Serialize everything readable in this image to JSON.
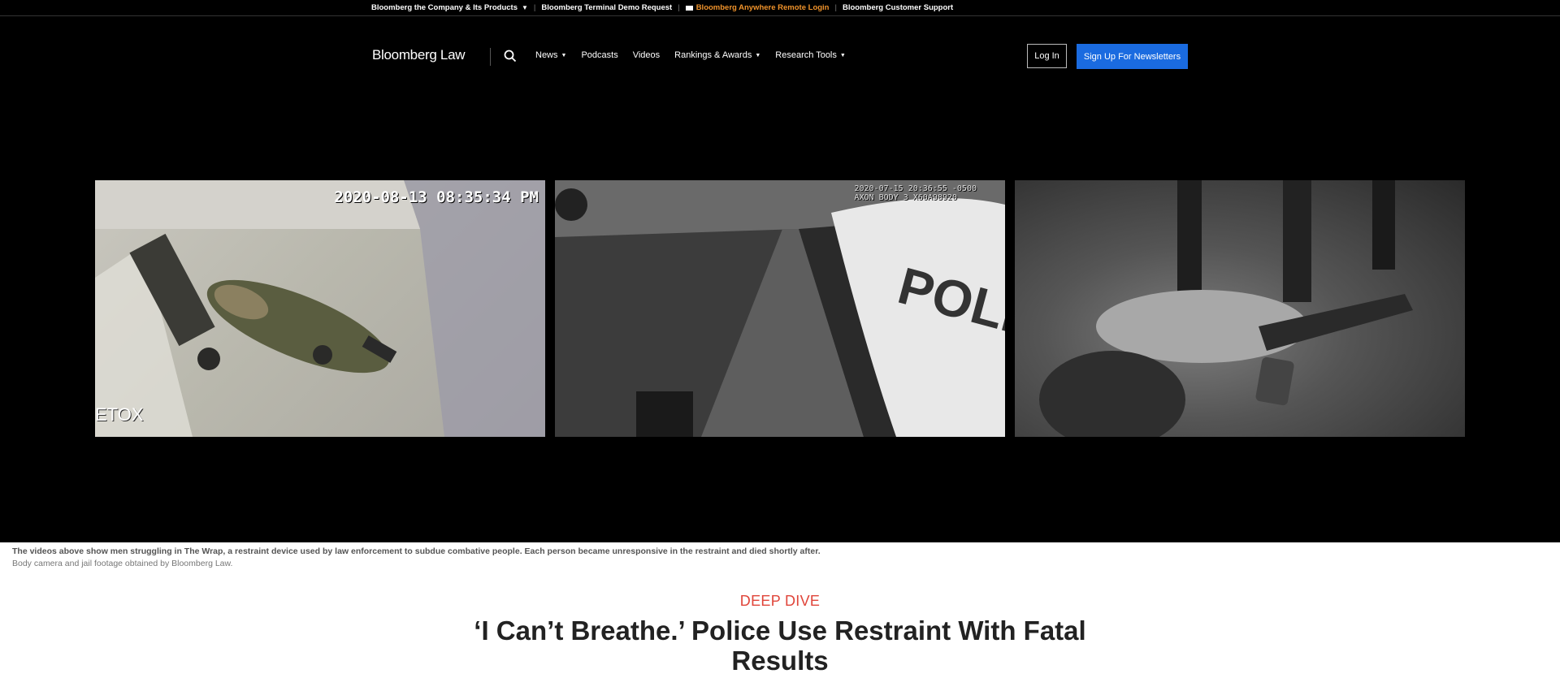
{
  "topbar": {
    "company": "Bloomberg the Company & Its Products",
    "demo": "Bloomberg Terminal Demo Request",
    "remote": "Bloomberg Anywhere Remote Login",
    "support": "Bloomberg Customer Support"
  },
  "header": {
    "logo": "Bloomberg Law",
    "nav": [
      "News",
      "Podcasts",
      "Videos",
      "Rankings & Awards",
      "Research Tools"
    ],
    "login": "Log In",
    "signup": "Sign Up For Newsletters"
  },
  "videos": [
    {
      "stamp": "2020-08-13 08:35:34 PM",
      "overlay": "ETOX"
    },
    {
      "stamp": "2020-07-15 20:36:55 -0500",
      "stamp2": "AXON BODY 3 X60A98920"
    },
    {}
  ],
  "caption": {
    "main": "The videos above show men struggling in The Wrap, a restraint device used by law enforcement to subdue combative people. Each person became unresponsive in the restraint and died shortly after.",
    "credit": "Body camera and jail footage obtained by Bloomberg Law."
  },
  "article": {
    "kicker": "DEEP DIVE",
    "headline": "‘I Can’t Breathe.’ Police Use Restraint With Fatal Results"
  }
}
